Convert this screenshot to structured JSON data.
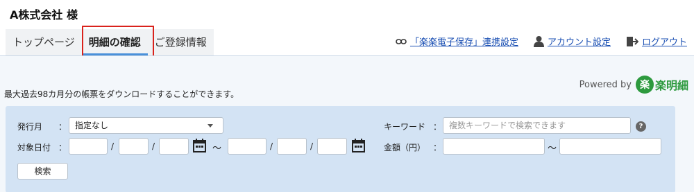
{
  "header": {
    "company_name": "A株式会社 様"
  },
  "tabs": [
    {
      "label": "トップページ",
      "active": false
    },
    {
      "label": "明細の確認",
      "active": true
    },
    {
      "label": "ご登録情報",
      "active": false
    }
  ],
  "topnav": {
    "link_settings": {
      "label": "「楽楽電子保存」連携設定",
      "icon": "link-icon"
    },
    "account_settings": {
      "label": "アカウント設定",
      "icon": "user-icon"
    },
    "logout": {
      "label": "ログアウト",
      "icon": "logout-icon"
    }
  },
  "notice": "最大過去98カ月分の帳票をダウンロードすることができます。",
  "branding": {
    "powered_by": "Powered by",
    "mark": "楽",
    "name": "楽明細",
    "color": "#2d9a3e"
  },
  "search": {
    "issue_month": {
      "label": "発行月",
      "colon": "：",
      "value": "指定なし"
    },
    "target_date": {
      "label": "対象日付",
      "colon": "：",
      "separator": "/",
      "range_separator": "〜"
    },
    "keyword": {
      "label": "キーワード",
      "colon": "：",
      "placeholder": "複数キーワードで検索できます",
      "help": "?"
    },
    "amount": {
      "label": "金額（円）",
      "colon": "：",
      "range_separator": "〜"
    },
    "submit_label": "検索"
  },
  "colors": {
    "highlight": "#d9221c",
    "link": "#1a4fb3",
    "panel": "#d3e3f4",
    "tab_underline": "#4a90d9"
  }
}
